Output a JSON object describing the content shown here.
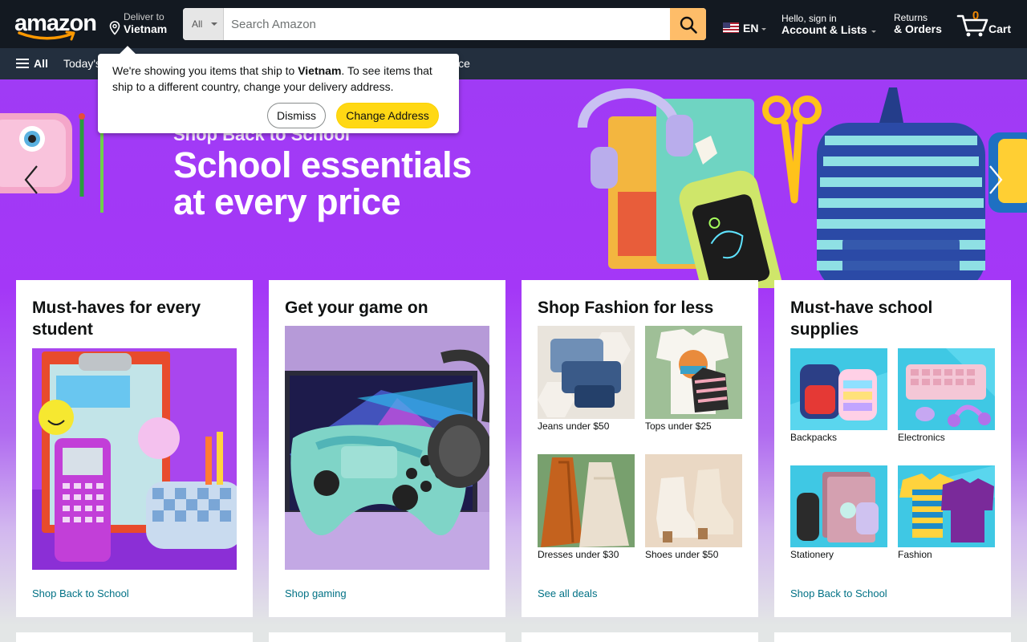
{
  "header": {
    "logo_text": "amazon",
    "deliver_line1": "Deliver to",
    "deliver_line2": "Vietnam",
    "search_category": "All",
    "search_placeholder": "Search Amazon",
    "language": "EN",
    "account_line1": "Hello, sign in",
    "account_line2": "Account & Lists",
    "orders_line1": "Returns",
    "orders_line2": "& Orders",
    "cart_count": "0",
    "cart_label": "Cart"
  },
  "nav": {
    "all_label": "All",
    "links_visible": [
      "Today's",
      "ice"
    ]
  },
  "popover": {
    "message_prefix": "We're showing you items that ship to ",
    "message_country": "Vietnam",
    "message_suffix": ". To see items that ship to a different country, change your delivery address.",
    "dismiss_label": "Dismiss",
    "change_label": "Change Address"
  },
  "hero": {
    "kicker": "Shop Back to School",
    "headline_line1": "School essentials",
    "headline_line2": "at every price"
  },
  "cards": [
    {
      "title": "Must-haves for every student",
      "link": "Shop Back to School"
    },
    {
      "title": "Get your game on",
      "link": "Shop gaming"
    },
    {
      "title": "Shop Fashion for less",
      "link": "See all deals",
      "tiles": [
        "Jeans under $50",
        "Tops under $25",
        "Dresses under $30",
        "Shoes under $50"
      ]
    },
    {
      "title": "Must-have school supplies",
      "link": "Shop Back to School",
      "tiles": [
        "Backpacks",
        "Electronics",
        "Stationery",
        "Fashion"
      ]
    }
  ],
  "colors": {
    "nav_belt": "#131921",
    "nav_main": "#232f3e",
    "search_button": "#febd69",
    "cart_count": "#f08804",
    "hero_purple": "#a437f7",
    "link_teal": "#007185",
    "primary_button": "#ffd814"
  },
  "icons": [
    "location-pin-icon",
    "search-icon",
    "caret-down-icon",
    "us-flag-icon",
    "cart-icon",
    "hamburger-icon",
    "chevron-left-icon",
    "chevron-right-icon"
  ]
}
